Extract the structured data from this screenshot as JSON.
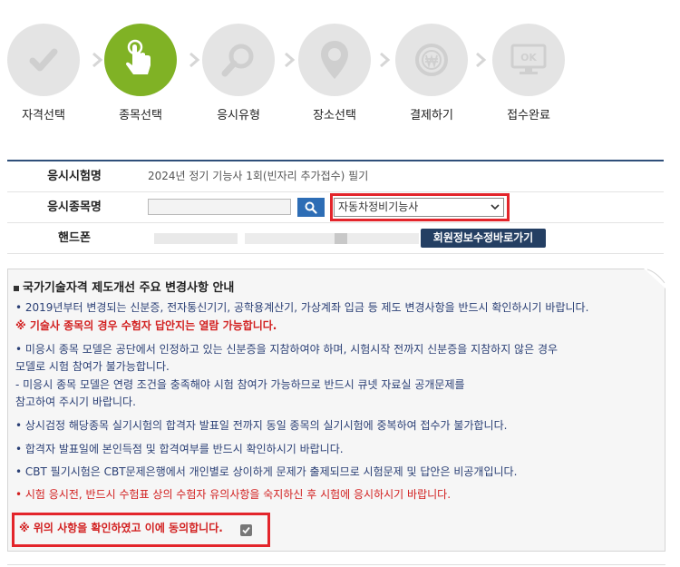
{
  "steps": [
    {
      "label": "자격선택",
      "icon": "check-icon",
      "active": false
    },
    {
      "label": "종목선택",
      "icon": "pointer-hand-icon",
      "active": true
    },
    {
      "label": "응시유형",
      "icon": "magnifier-icon",
      "active": false
    },
    {
      "label": "장소선택",
      "icon": "location-pin-icon",
      "active": false
    },
    {
      "label": "결제하기",
      "icon": "won-coin-icon",
      "active": false
    },
    {
      "label": "접수완료",
      "icon": "ok-monitor-icon",
      "active": false
    }
  ],
  "ok_icon_text": "OK",
  "form": {
    "exam_name_label": "응시시험명",
    "exam_name_value": "2024년 정기 기능사 1회(빈자리 추가접수) 필기",
    "subject_label": "응시종목명",
    "subject_selected": "자동차정비기능사",
    "phone_label": "핸드폰",
    "member_button": "회원정보수정바로가기"
  },
  "notice": {
    "title": "국가기술자격 제도개선 주요 변경사항 안내",
    "lines": [
      "• 2019년부터 변경되는 신분증, 전자통신기기, 공학용계산기, 가상계좌 입금 등 제도 변경사항을 반드시 확인하시기 바랍니다.",
      "※ 기술사 종목의 경우 수험자 답안지는 열람 가능합니다.",
      "• 미응시 종목 모델은 공단에서 인정하고 있는 신분증을 지참하여야 하며, 시험시작 전까지 신분증을 지참하지 않은 경우",
      "   모델로 시험 참여가 불가능합니다.",
      "  - 미응시 종목 모델은 연령 조건을 충족해야 시험 참여가 가능하므로 반드시 큐넷 자료실 공개문제를",
      "     참고하여 주시기 바랍니다.",
      "• 상시검정 해당종목 실기시험의 합격자 발표일 전까지 동일 종목의 실기시험에 중복하여 접수가 불가합니다.",
      "• 합격자 발표일에 본인득점 및 합격여부를 반드시 확인하시기 바랍니다.",
      "• CBT 필기시험은 CBT문제은행에서 개인별로 상이하게 문제가 출제되므로 시험문제 및 답안은 비공개입니다.",
      "• 시험 응시전, 반드시 수험표 상의 수험자 유의사항을 숙지하신 후 시험에 응시하시기 바랍니다."
    ],
    "agree_text": "※ 위의 사항을 확인하였고 이에 동의합니다."
  },
  "colors": {
    "active_step": "#80b225",
    "inactive_step": "#e4e4e4",
    "highlight": "#e3252b",
    "navy": "#243f63"
  }
}
